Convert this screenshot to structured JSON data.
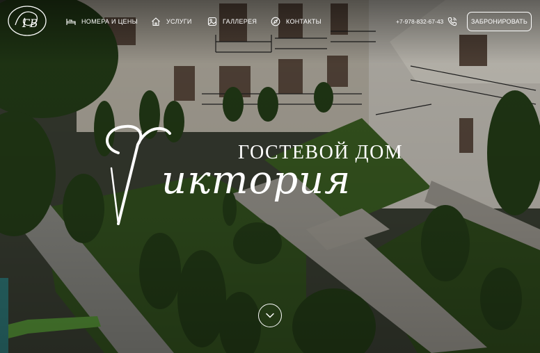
{
  "brand": {
    "logo_text": "ГВ"
  },
  "nav": {
    "rooms": "НОМЕРА И ЦЕНЫ",
    "services": "УСЛУГИ",
    "gallery": "ГАЛЛЕРЕЯ",
    "contacts": "КОНТАКТЫ"
  },
  "phone": "+7-978-832-67-43",
  "book_button": "ЗАБРОНИРОВАТЬ",
  "hero": {
    "subtitle": "ГОСТЕВОЙ ДОМ",
    "title_initial": "V",
    "title": "иктория"
  },
  "icons": {
    "rooms": "bed-icon",
    "services": "home-icon",
    "gallery": "image-icon",
    "contacts": "compass-icon",
    "phone": "phone-icon",
    "scroll": "chevron-down-icon"
  }
}
